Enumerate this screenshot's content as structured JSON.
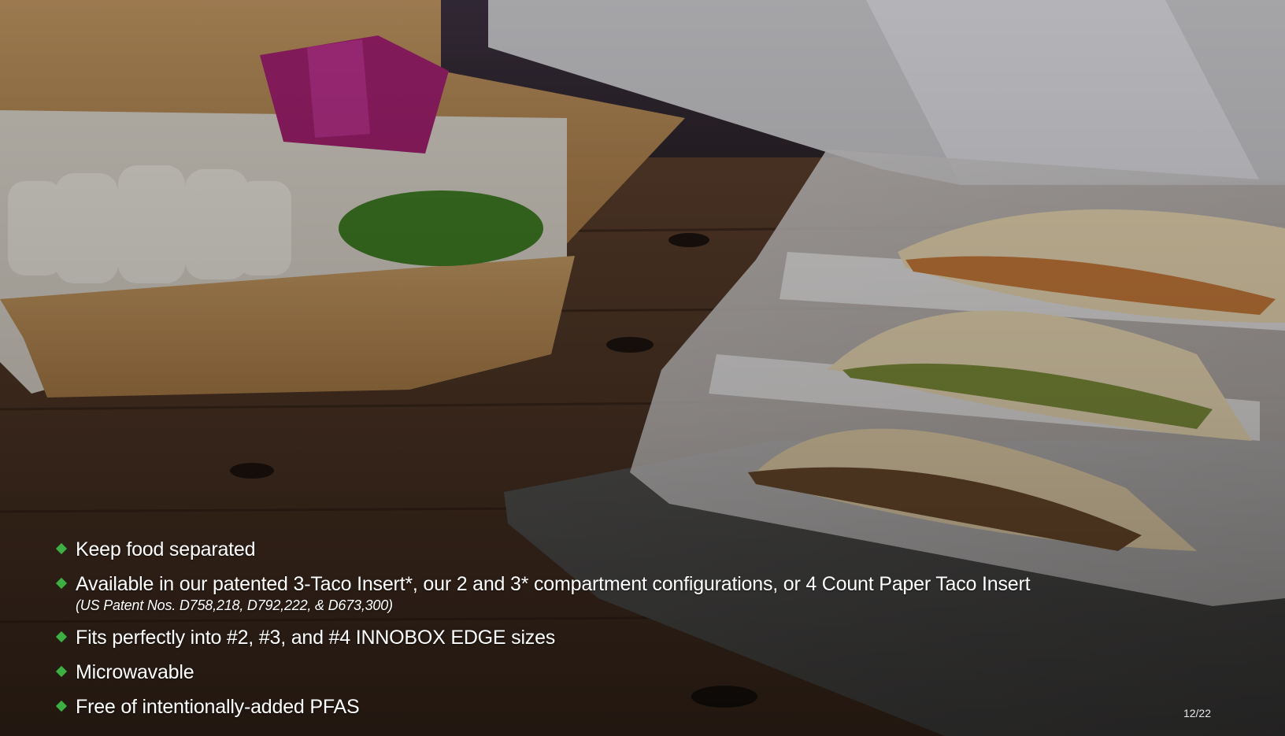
{
  "slide": {
    "bullets": [
      {
        "text": "Keep food separated",
        "note": ""
      },
      {
        "text": "Available in our patented 3-Taco Insert*, our 2 and 3* compartment configurations, or 4 Count Paper Taco Insert",
        "note": "(US Patent Nos. D758,218, D792,222, & D673,300)"
      },
      {
        "text": "Fits perfectly into #2, #3, and #4 INNOBOX EDGE sizes",
        "note": ""
      },
      {
        "text": "Microwavable",
        "note": ""
      },
      {
        "text": "Free of intentionally-added PFAS",
        "note": ""
      }
    ],
    "page_number": "12/22",
    "bullet_icon": "green-diamond-icon",
    "colors": {
      "bullet_accent": "#3cb043",
      "text": "#ffffff"
    }
  }
}
